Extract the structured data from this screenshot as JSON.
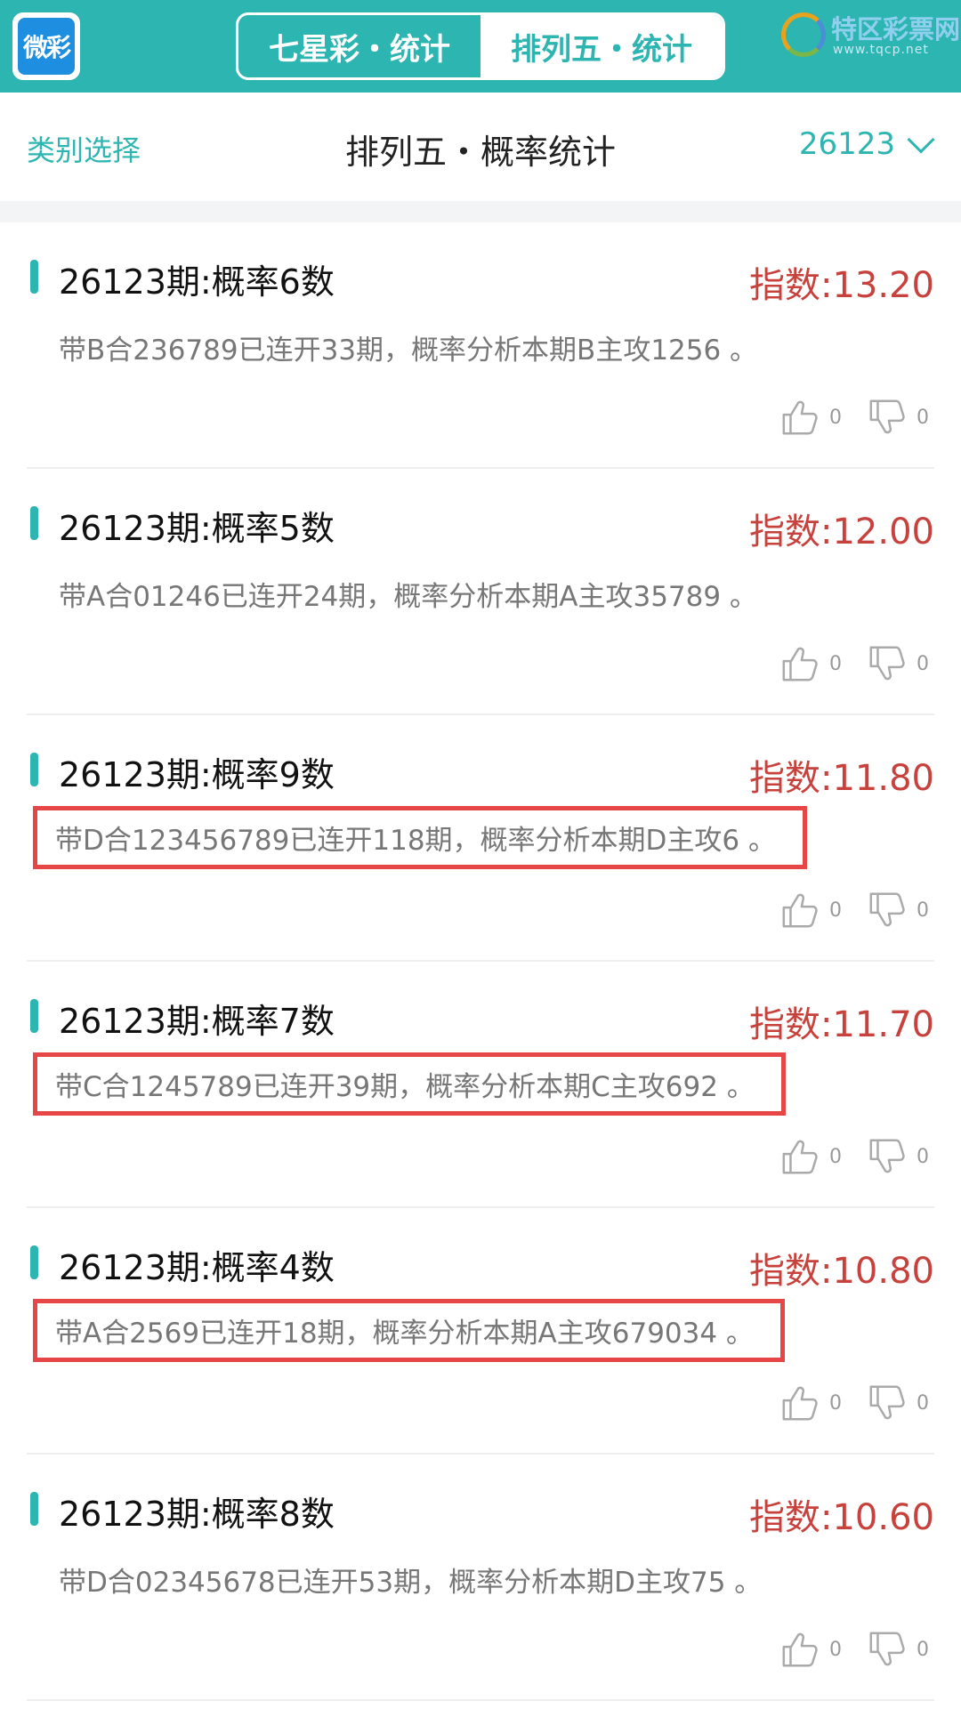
{
  "topbar": {
    "logo_text": "微彩",
    "tabs": [
      {
        "label": "七星彩・统计",
        "active": false
      },
      {
        "label": "排列五・统计",
        "active": true
      }
    ],
    "watermark_name": "特区彩票网",
    "watermark_url": "www.tqcp.net"
  },
  "subheader": {
    "category_label": "类别选择",
    "title": "排列五・概率统计",
    "issue": "26123"
  },
  "colors": {
    "accent": "#2db5b2",
    "index_red": "#c8423d",
    "highlight_box": "#e64646"
  },
  "items": [
    {
      "title": "26123期:概率6数",
      "index": "指数:13.20",
      "desc": "带B合236789已连开33期，概率分析本期B主攻1256 。",
      "likes": "0",
      "dislikes": "0",
      "boxed": false
    },
    {
      "title": "26123期:概率5数",
      "index": "指数:12.00",
      "desc": "带A合01246已连开24期，概率分析本期A主攻35789 。",
      "likes": "0",
      "dislikes": "0",
      "boxed": false
    },
    {
      "title": "26123期:概率9数",
      "index": "指数:11.80",
      "desc": "带D合123456789已连开118期，概率分析本期D主攻6 。",
      "likes": "0",
      "dislikes": "0",
      "boxed": true
    },
    {
      "title": "26123期:概率7数",
      "index": "指数:11.70",
      "desc": "带C合1245789已连开39期，概率分析本期C主攻692 。",
      "likes": "0",
      "dislikes": "0",
      "boxed": true
    },
    {
      "title": "26123期:概率4数",
      "index": "指数:10.80",
      "desc": "带A合2569已连开18期，概率分析本期A主攻679034 。",
      "likes": "0",
      "dislikes": "0",
      "boxed": true
    },
    {
      "title": "26123期:概率8数",
      "index": "指数:10.60",
      "desc": "带D合02345678已连开53期，概率分析本期D主攻75 。",
      "likes": "0",
      "dislikes": "0",
      "boxed": false
    }
  ],
  "icons": {
    "like": "thumbs-up-icon",
    "dislike": "thumbs-down-icon",
    "dropdown": "chevron-down-icon"
  }
}
